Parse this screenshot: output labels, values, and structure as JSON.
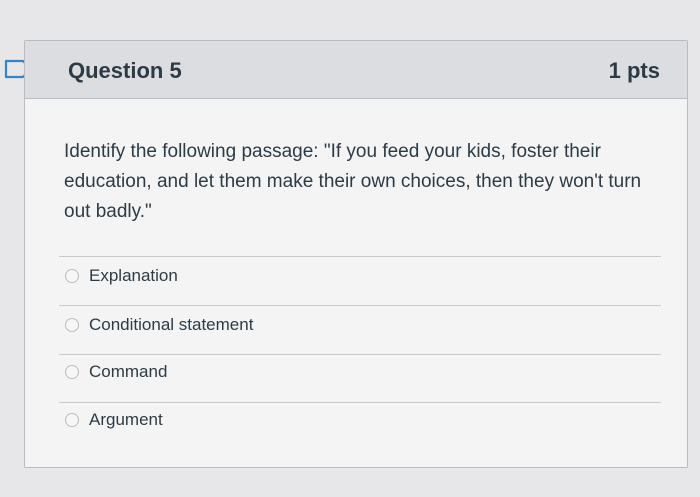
{
  "question": {
    "title": "Question 5",
    "points": "1 pts",
    "text": "Identify the following passage: \"If you feed your kids, foster their education, and let them make their own choices, then they won't turn out badly.\""
  },
  "answers": [
    {
      "label": "Explanation"
    },
    {
      "label": "Conditional statement"
    },
    {
      "label": "Command"
    },
    {
      "label": "Argument"
    }
  ],
  "colors": {
    "background": "#e7e7e9",
    "card": "#f4f4f5",
    "header": "#dcdde0",
    "text": "#2d3b45",
    "flag_outline": "#3b82c4"
  },
  "icons": {
    "flag": "flag-question-icon",
    "radio": "radio-button-icon"
  }
}
